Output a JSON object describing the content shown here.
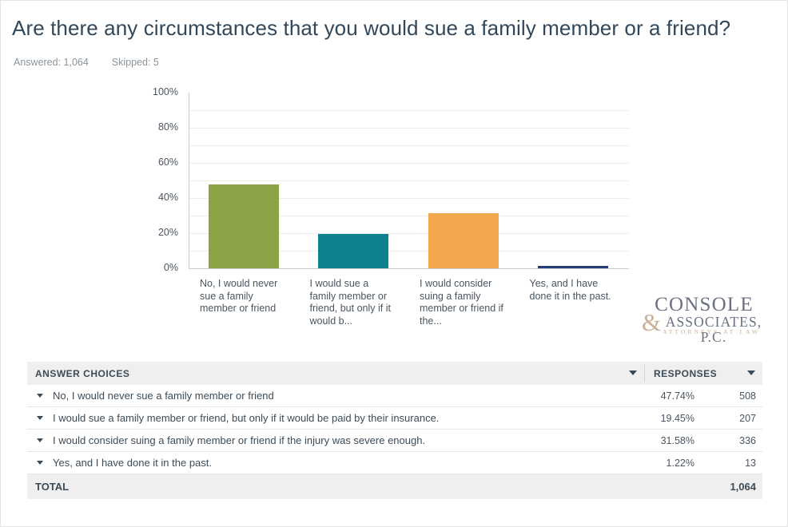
{
  "header": {
    "question": "Are there any circumstances that you would sue a family member or a friend?",
    "answered_label": "Answered: 1,064",
    "skipped_label": "Skipped: 5"
  },
  "chart_data": {
    "type": "bar",
    "title": "Are there any circumstances that you would sue a family member or a friend?",
    "xlabel": "",
    "ylabel": "",
    "ylim": [
      0,
      100
    ],
    "ytick_labels": [
      "0%",
      "20%",
      "40%",
      "60%",
      "80%",
      "100%"
    ],
    "ytick_values": [
      0,
      20,
      40,
      60,
      80,
      100
    ],
    "gridlines_every": 10,
    "grid": true,
    "legend": "none",
    "categories": [
      "No, I would never sue a family member or friend",
      "I would sue a family member or friend, but only if it would b...",
      "I would consider suing a family member or friend if the...",
      "Yes, and I have done it in the past."
    ],
    "values": [
      47.74,
      19.45,
      31.58,
      1.22
    ],
    "counts": [
      508,
      207,
      336,
      13
    ],
    "colors": [
      "#89a345",
      "#0e828c",
      "#f2a74c",
      "#223d77"
    ]
  },
  "logo": {
    "line1": "CONSOLE",
    "ampersand": "&",
    "line2": "ASSOCIATES, P.C.",
    "tagline": "ATTORNEYS AT LAW"
  },
  "table": {
    "header": {
      "choices": "ANSWER CHOICES",
      "responses": "RESPONSES"
    },
    "rows": [
      {
        "label": "No, I would never sue a family member or friend",
        "percent": "47.74%",
        "count": "508"
      },
      {
        "label": "I would sue a family member or friend, but only if it would be paid by their insurance.",
        "percent": "19.45%",
        "count": "207"
      },
      {
        "label": "I would consider suing a family member or friend if the injury was severe enough.",
        "percent": "31.58%",
        "count": "336"
      },
      {
        "label": "Yes, and I have done it in the past.",
        "percent": "1.22%",
        "count": "13"
      }
    ],
    "total": {
      "label": "TOTAL",
      "value": "1,064"
    }
  }
}
